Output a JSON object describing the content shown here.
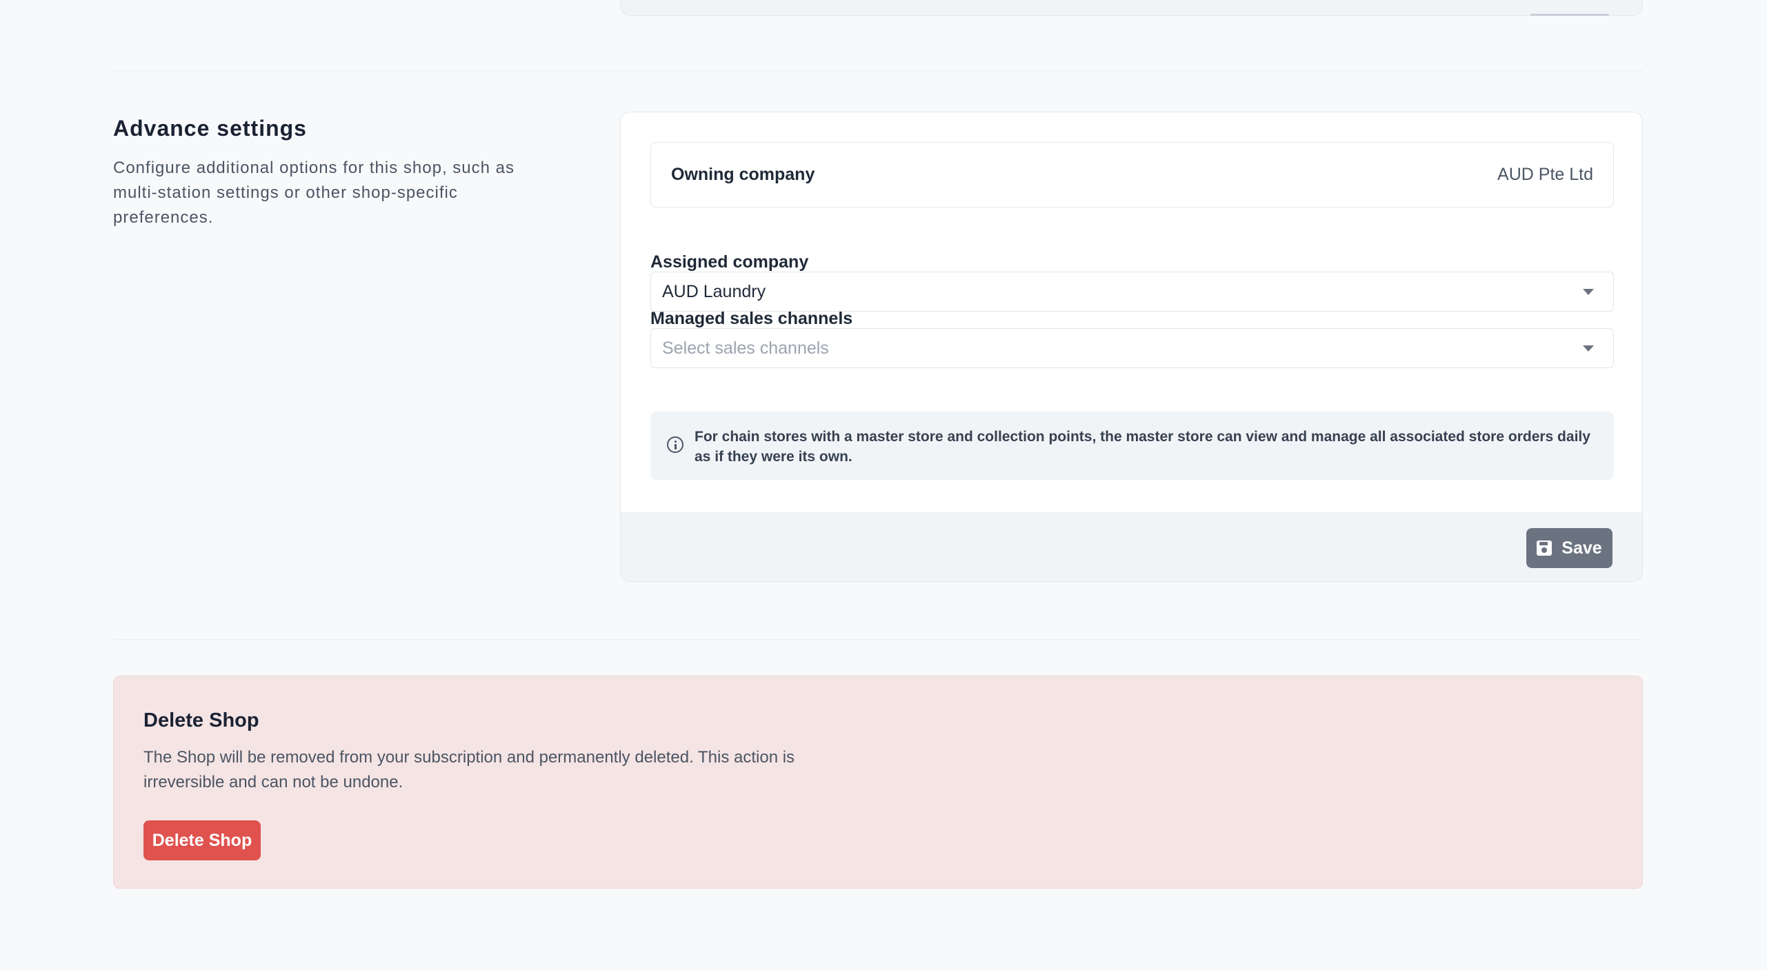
{
  "advance_settings": {
    "title": "Advance settings",
    "description": "Configure additional options for this shop, such as multi-station settings or other shop-specific preferences.",
    "owning_company": {
      "label": "Owning company",
      "value": "AUD Pte Ltd"
    },
    "assigned_company": {
      "label": "Assigned company",
      "value": "AUD Laundry"
    },
    "managed_sales_channels": {
      "label": "Managed sales channels",
      "placeholder": "Select sales channels"
    },
    "info_note": "For chain stores with a master store and collection points, the master store can view and manage all associated store orders daily as if they were its own.",
    "save_label": "Save"
  },
  "delete_shop": {
    "title": "Delete Shop",
    "description": "The Shop will be removed from your subscription and permanently deleted. This action is irreversible and can not be undone.",
    "button_label": "Delete Shop"
  },
  "colors": {
    "danger": "#e0524e",
    "danger_bg": "#f5e4e4",
    "save_button": "#6b7280",
    "page_bg": "#f8f9fb"
  }
}
